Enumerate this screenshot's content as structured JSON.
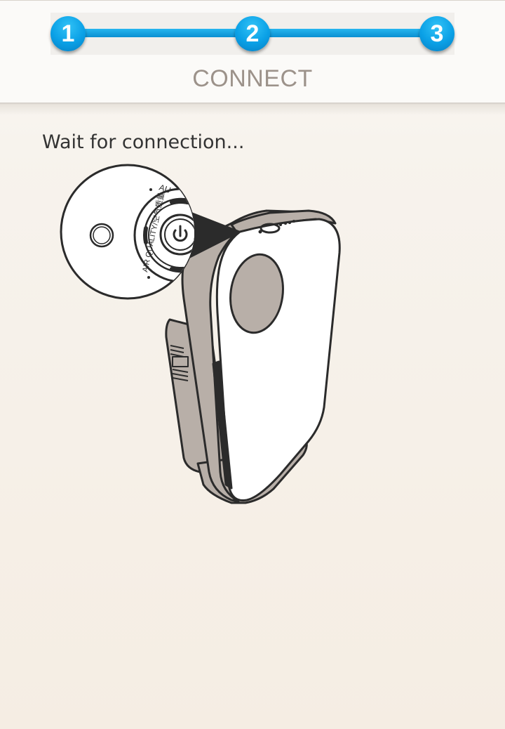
{
  "stepper": {
    "steps": [
      "1",
      "2",
      "3"
    ],
    "active_color": "#0aa0e6"
  },
  "header": {
    "title": "CONNECT"
  },
  "main": {
    "instruction": "Wait for connection...",
    "illustration": {
      "icon": "air-purifier-illustration",
      "dial_label": "AIR QUALITY/空气质量",
      "dial_mode_text": "AU",
      "power_icon": "power-icon"
    }
  }
}
